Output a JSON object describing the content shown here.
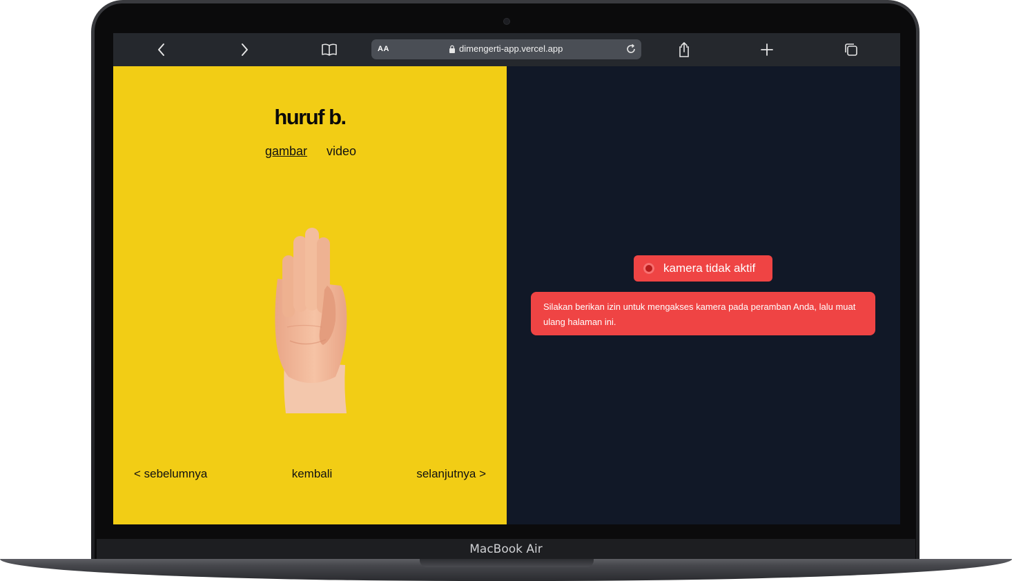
{
  "device": {
    "label": "MacBook Air"
  },
  "browser": {
    "text_size_label": "AA",
    "url": "dimengerti-app.vercel.app",
    "icons": [
      "chevron-left-icon",
      "chevron-right-icon",
      "book-icon",
      "lock-icon",
      "reload-icon",
      "share-icon",
      "plus-icon",
      "tabs-icon"
    ]
  },
  "page": {
    "title": "huruf b.",
    "tabs": [
      {
        "label": "gambar",
        "active": true
      },
      {
        "label": "video",
        "active": false
      }
    ],
    "nav": {
      "prev_label": "< sebelumnya",
      "back_label": "kembali",
      "next_label": "selanjutnya >"
    },
    "camera": {
      "status_label": "kamera tidak aktif",
      "message": "Silakan berikan izin untuk mengakses kamera pada peramban Anda, lalu muat ulang halaman ini."
    }
  },
  "colors": {
    "left_panel": "#f2cd15",
    "right_panel": "#111827",
    "alert": "#ef4444",
    "toolbar": "#25282d"
  }
}
